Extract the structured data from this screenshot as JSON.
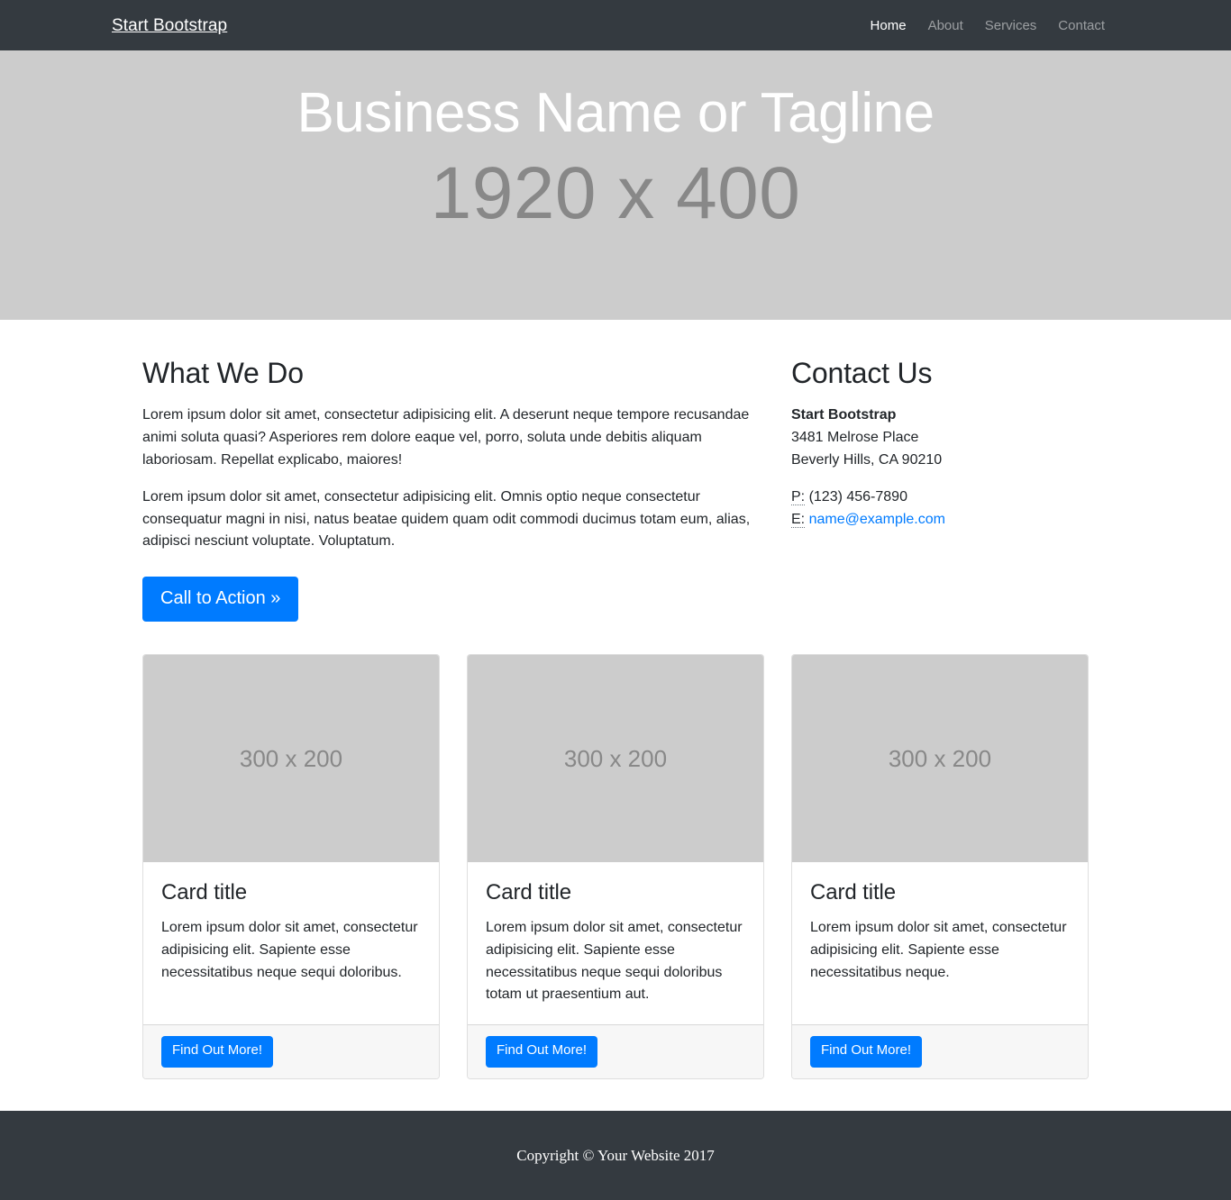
{
  "navbar": {
    "brand": "Start Bootstrap",
    "items": [
      {
        "label": "Home",
        "active": true
      },
      {
        "label": "About",
        "active": false
      },
      {
        "label": "Services",
        "active": false
      },
      {
        "label": "Contact",
        "active": false
      }
    ]
  },
  "hero": {
    "caption": "Business Name or Tagline",
    "placeholder": "1920 x 400"
  },
  "what_we_do": {
    "title": "What We Do",
    "paragraph1": "Lorem ipsum dolor sit amet, consectetur adipisicing elit. A deserunt neque tempore recusandae animi soluta quasi? Asperiores rem dolore eaque vel, porro, soluta unde debitis aliquam laboriosam. Repellat explicabo, maiores!",
    "paragraph2": "Lorem ipsum dolor sit amet, consectetur adipisicing elit. Omnis optio neque consectetur consequatur magni in nisi, natus beatae quidem quam odit commodi ducimus totam eum, alias, adipisci nesciunt voluptate. Voluptatum.",
    "cta_label": "Call to Action »"
  },
  "contact": {
    "title": "Contact Us",
    "company": "Start Bootstrap",
    "address_line1": "3481 Melrose Place",
    "address_line2": "Beverly Hills, CA 90210",
    "phone_abbr": "P:",
    "phone": "(123) 456-7890",
    "email_abbr": "E:",
    "email": "name@example.com"
  },
  "cards": [
    {
      "image_label": "300 x 200",
      "title": "Card title",
      "text": "Lorem ipsum dolor sit amet, consectetur adipisicing elit. Sapiente esse necessitatibus neque sequi doloribus.",
      "button_label": "Find Out More!"
    },
    {
      "image_label": "300 x 200",
      "title": "Card title",
      "text": "Lorem ipsum dolor sit amet, consectetur adipisicing elit. Sapiente esse necessitatibus neque sequi doloribus totam ut praesentium aut.",
      "button_label": "Find Out More!"
    },
    {
      "image_label": "300 x 200",
      "title": "Card title",
      "text": "Lorem ipsum dolor sit amet, consectetur adipisicing elit. Sapiente esse necessitatibus neque.",
      "button_label": "Find Out More!"
    }
  ],
  "footer": {
    "copyright": "Copyright © Your Website 2017"
  },
  "colors": {
    "navbar_bg": "#343a40",
    "footer_bg": "#343a40",
    "placeholder_bg": "#cccccc",
    "placeholder_text": "#888888",
    "primary": "#007bff",
    "link": "#007bff",
    "card_footer_bg": "#f7f7f7"
  }
}
